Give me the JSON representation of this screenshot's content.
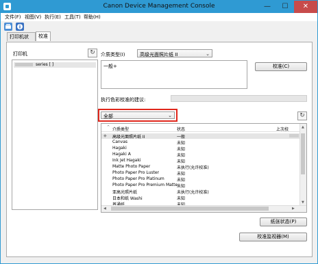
{
  "window": {
    "title": "Canon Device Management Console",
    "minimize_glyph": "—",
    "maximize_glyph": "☐",
    "close_glyph": "✕"
  },
  "menu": [
    "文件(F)",
    "视图(V)",
    "执行(E)",
    "工具(T)",
    "帮助(H)"
  ],
  "toolbar": {
    "icons": [
      "printer-refresh-icon",
      "printer-info-icon"
    ]
  },
  "tabs": [
    {
      "label": "打印机状态",
      "active": false
    },
    {
      "label": "校准",
      "active": true
    }
  ],
  "printer_panel": {
    "label": "打印机",
    "refresh_glyph": "↻",
    "items": [
      "series [                    ]"
    ]
  },
  "media": {
    "label": "介质类型(I)",
    "selected": "高级光面照片纸 II",
    "description": "一般+",
    "calibrate_button": "校准(C)",
    "suggestion_label": "执行色彩校准的建议:"
  },
  "filter": {
    "selected": "全部",
    "refresh_glyph": "↻"
  },
  "table": {
    "columns": [
      "介质类型",
      "状态",
      "上次校"
    ],
    "rows": [
      {
        "type": "高级光面照片纸 II",
        "status": "一般",
        "selected": true
      },
      {
        "type": "Canvas",
        "status": "未知"
      },
      {
        "type": "Hagaki",
        "status": "未知"
      },
      {
        "type": "Hagaki A",
        "status": "未知"
      },
      {
        "type": "Ink Jet Hagaki",
        "status": "未知"
      },
      {
        "type": "Matte Photo Paper",
        "status": "未执行(允许校准)"
      },
      {
        "type": "Photo Paper Pro Luster",
        "status": "未知"
      },
      {
        "type": "Photo Paper Pro Platinum",
        "status": "未知"
      },
      {
        "type": "Photo Paper Pro Premium Matte",
        "status": "未知"
      },
      {
        "type": "亚高光照片纸",
        "status": "未执行(允许校准)"
      },
      {
        "type": "日本和纸 Washi",
        "status": "未知"
      },
      {
        "type": "普通纸",
        "status": "未知"
      }
    ]
  },
  "buttons": {
    "paper_status": "纸张状态(P)",
    "calibration_monitor": "校准监视器(M)"
  },
  "colors": {
    "title_bar": "#2f9ad3",
    "highlight_border": "#e0261b"
  }
}
